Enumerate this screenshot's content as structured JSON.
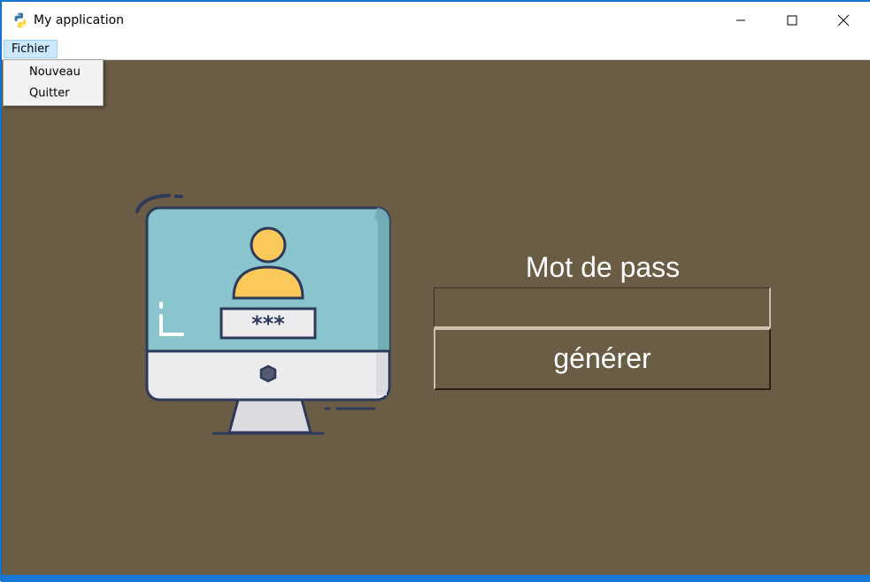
{
  "window": {
    "title": "My application"
  },
  "menubar": {
    "fichier_label": "Fichier"
  },
  "dropdown": {
    "items": [
      {
        "label": "Nouveau"
      },
      {
        "label": "Quitter"
      }
    ]
  },
  "main": {
    "password_label": "Mot de pass",
    "password_value": "",
    "generate_label": "générer",
    "illustration_asterisks": "***"
  },
  "colors": {
    "background": "#6b5d45",
    "text": "#ffffff",
    "monitor_screen": "#8ac5cd",
    "avatar_yellow": "#fbc85a",
    "outline": "#2e3a5c"
  },
  "icons": [
    "python-app-icon",
    "minimize-icon",
    "maximize-icon",
    "close-icon",
    "monitor-login-illustration"
  ]
}
